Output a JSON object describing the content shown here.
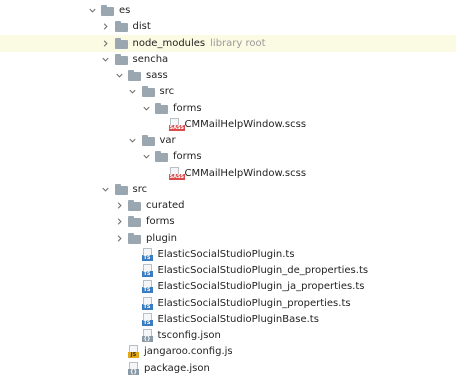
{
  "tree": {
    "rows": [
      {
        "depth": 0,
        "chevron": "chevron-down-icon",
        "icon": "folder-icon",
        "label": "es"
      },
      {
        "depth": 1,
        "chevron": "chevron-right-icon",
        "icon": "folder-icon",
        "label": "dist"
      },
      {
        "depth": 1,
        "chevron": "chevron-right-icon",
        "icon": "folder-icon",
        "label": "node_modules",
        "hint": "library root",
        "selected": true
      },
      {
        "depth": 1,
        "chevron": "chevron-down-icon",
        "icon": "folder-icon",
        "label": "sencha"
      },
      {
        "depth": 2,
        "chevron": "chevron-down-icon",
        "icon": "folder-icon",
        "label": "sass"
      },
      {
        "depth": 3,
        "chevron": "chevron-down-icon",
        "icon": "folder-icon",
        "label": "src"
      },
      {
        "depth": 4,
        "chevron": "chevron-down-icon",
        "icon": "folder-icon",
        "label": "forms"
      },
      {
        "depth": 5,
        "chevron": "",
        "icon": "sass-file-icon",
        "tag": "SASS",
        "label": "CMMailHelpWindow.scss"
      },
      {
        "depth": 3,
        "chevron": "chevron-down-icon",
        "icon": "folder-icon",
        "label": "var"
      },
      {
        "depth": 4,
        "chevron": "chevron-down-icon",
        "icon": "folder-icon",
        "label": "forms"
      },
      {
        "depth": 5,
        "chevron": "",
        "icon": "sass-file-icon",
        "tag": "SASS",
        "label": "CMMailHelpWindow.scss"
      },
      {
        "depth": 1,
        "chevron": "chevron-down-icon",
        "icon": "folder-icon",
        "label": "src"
      },
      {
        "depth": 2,
        "chevron": "chevron-right-icon",
        "icon": "folder-icon",
        "label": "curated"
      },
      {
        "depth": 2,
        "chevron": "chevron-right-icon",
        "icon": "folder-icon",
        "label": "forms"
      },
      {
        "depth": 2,
        "chevron": "chevron-right-icon",
        "icon": "folder-icon",
        "label": "plugin"
      },
      {
        "depth": 3,
        "chevron": "",
        "icon": "typescript-file-icon",
        "tag": "TS",
        "label": "ElasticSocialStudioPlugin.ts"
      },
      {
        "depth": 3,
        "chevron": "",
        "icon": "typescript-file-icon",
        "tag": "TS",
        "label": "ElasticSocialStudioPlugin_de_properties.ts"
      },
      {
        "depth": 3,
        "chevron": "",
        "icon": "typescript-file-icon",
        "tag": "TS",
        "label": "ElasticSocialStudioPlugin_ja_properties.ts"
      },
      {
        "depth": 3,
        "chevron": "",
        "icon": "typescript-file-icon",
        "tag": "TS",
        "label": "ElasticSocialStudioPlugin_properties.ts"
      },
      {
        "depth": 3,
        "chevron": "",
        "icon": "typescript-file-icon",
        "tag": "TS",
        "label": "ElasticSocialStudioPluginBase.ts"
      },
      {
        "depth": 3,
        "chevron": "",
        "icon": "json-file-icon",
        "tag": "{}",
        "label": "tsconfig.json"
      },
      {
        "depth": 2,
        "chevron": "",
        "icon": "javascript-file-icon",
        "tag": "JS",
        "label": "jangaroo.config.js"
      },
      {
        "depth": 2,
        "chevron": "",
        "icon": "json-file-icon",
        "tag": "{}",
        "label": "package.json"
      }
    ]
  },
  "colors": {
    "selected_row": "#fbfbe4",
    "folder": "#9aa7b0",
    "hint_text": "#9a9a9a",
    "sass_tag": "#d94b4b",
    "ts_tag": "#3b7bbf",
    "js_tag": "#e0a81c",
    "json_tag": "#8a99a6"
  }
}
